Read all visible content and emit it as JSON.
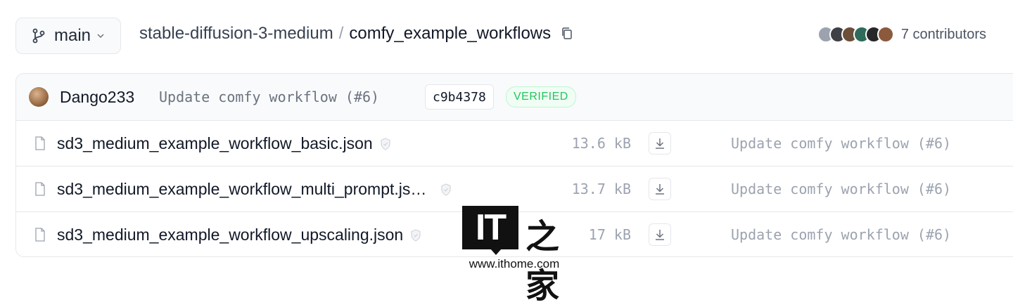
{
  "header": {
    "branch": "main",
    "repo": "stable-diffusion-3-medium",
    "separator": "/",
    "directory": "comfy_example_workflows",
    "contributors_label": "7 contributors",
    "contributor_avatar_colors": [
      "#9ca3af",
      "#3f3f46",
      "#6b4f3a",
      "#2f6b5a",
      "#27272a",
      "#8b5a3c"
    ]
  },
  "last_commit": {
    "author": "Dango233",
    "message": "Update comfy workflow (#6)",
    "hash": "c9b4378",
    "verified_label": "VERIFIED"
  },
  "files": [
    {
      "name": "sd3_medium_example_workflow_basic.json",
      "size": "13.6 kB",
      "commit": "Update comfy workflow (#6)"
    },
    {
      "name": "sd3_medium_example_workflow_multi_prompt.js…",
      "size": "13.7 kB",
      "commit": "Update comfy workflow (#6)"
    },
    {
      "name": "sd3_medium_example_workflow_upscaling.json",
      "size": "17 kB",
      "commit": "Update comfy workflow (#6)"
    }
  ],
  "watermark": {
    "logo_text": "IT之家",
    "url": "www.ithome.com"
  },
  "colors": {
    "verified": "#22c55e",
    "muted": "#9ca3af"
  }
}
